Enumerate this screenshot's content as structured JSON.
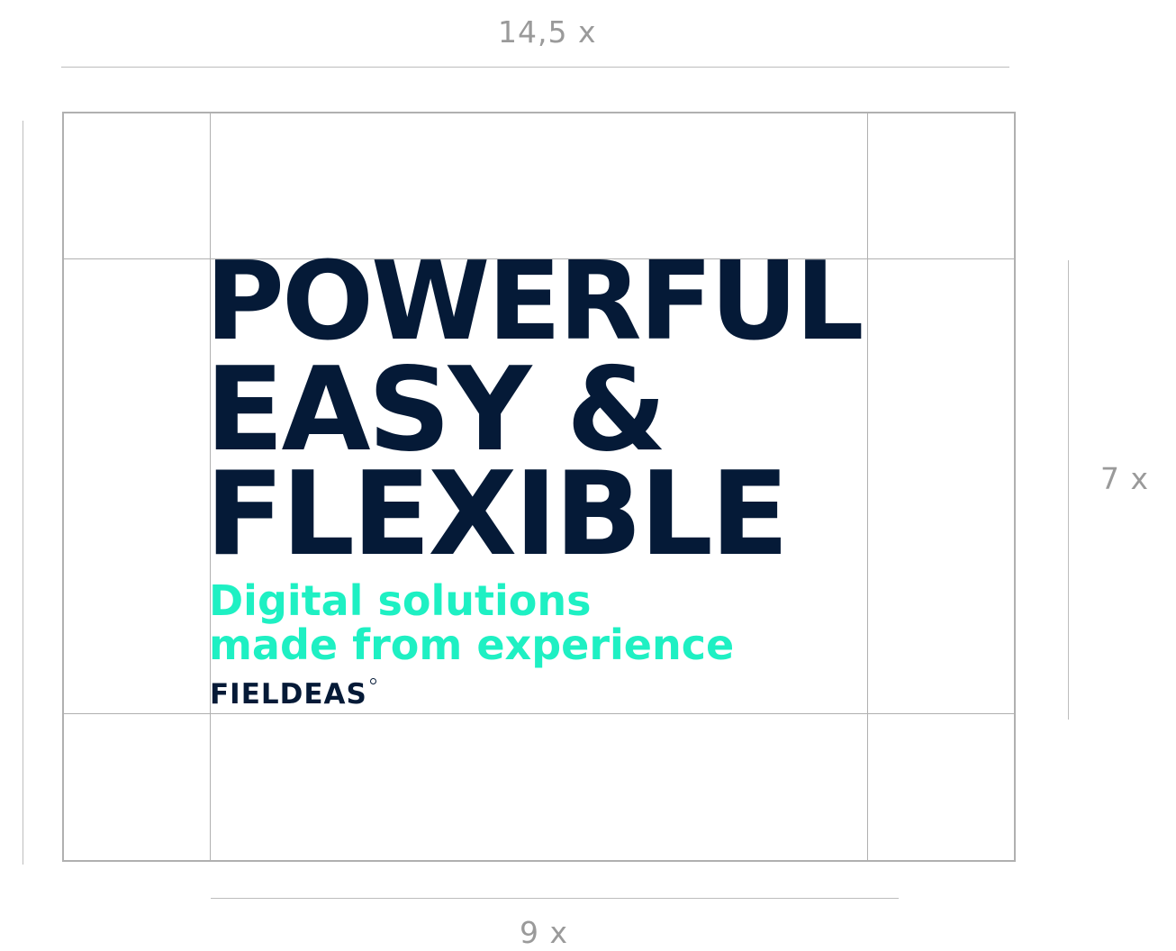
{
  "dimensions": {
    "top_label": "14,5 x",
    "right_label": "7 x",
    "bottom_label": "9 x"
  },
  "content": {
    "headline_lines": [
      "POWERFUL",
      "EASY &",
      "FLEXIBLE"
    ],
    "tagline_lines": [
      "Digital solutions",
      "made from experience"
    ],
    "brand": "FIELDEAS"
  },
  "colors": {
    "headline": "#051a37",
    "tagline": "#1ef0c3",
    "guides": "#b0b0b0",
    "dimension_text": "#9a9a9a"
  }
}
